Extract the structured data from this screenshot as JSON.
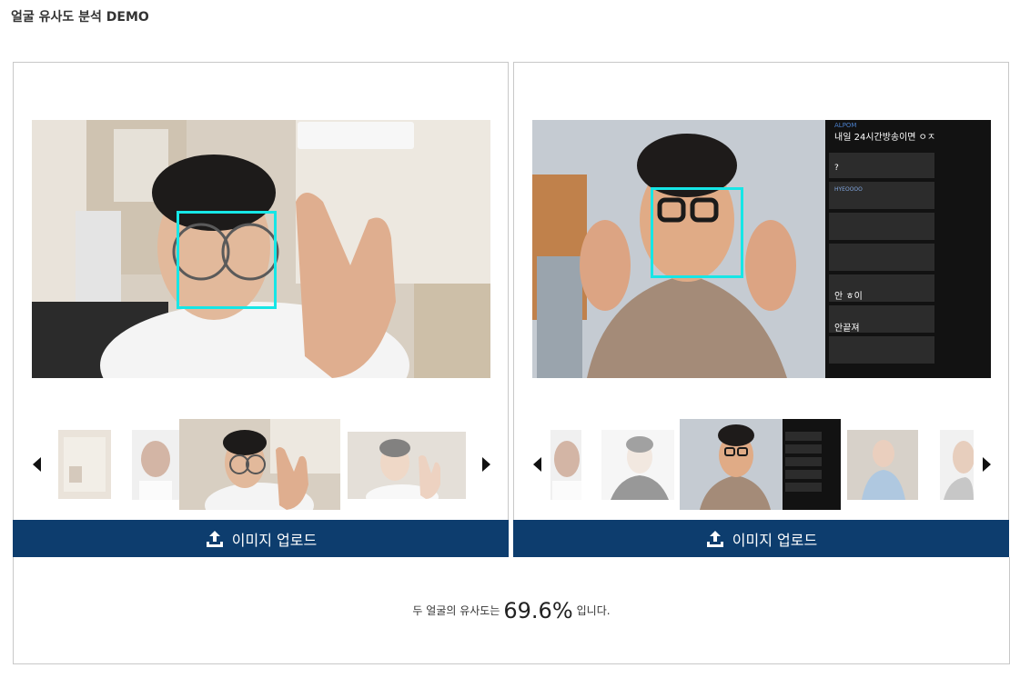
{
  "header": {
    "title": "얼굴 유사도 분석 DEMO"
  },
  "left_panel": {
    "upload_label": "이미지 업로드",
    "thumbnails": [
      "passport-photo",
      "man-portrait",
      "glasses-selfie",
      "glasses-selfie-2"
    ],
    "selected_thumbnail": 2
  },
  "right_panel": {
    "upload_label": "이미지 업로드",
    "overlay_text": {
      "header": "ALPOM",
      "line1": "내일 24시간방송이면 ㅇㅈ",
      "line2": "?",
      "line3": "HYEOOOO",
      "line4": "안 ㅎ이",
      "line5": "안끝져"
    },
    "thumbnails": [
      "man-portrait",
      "sketch-portrait",
      "glasses-stream",
      "smiling-man",
      "man-side"
    ],
    "selected_thumbnail": 2
  },
  "result": {
    "prefix": "두 얼굴의 유사도는",
    "value": "69.6%",
    "suffix": "입니다."
  },
  "colors": {
    "upload_button": "#0d3d6e",
    "face_box": "#16e6e6",
    "border": "#c8c8c8"
  },
  "icons": {
    "upload": "upload-icon",
    "prev": "arrow-left-icon",
    "next": "arrow-right-icon"
  }
}
